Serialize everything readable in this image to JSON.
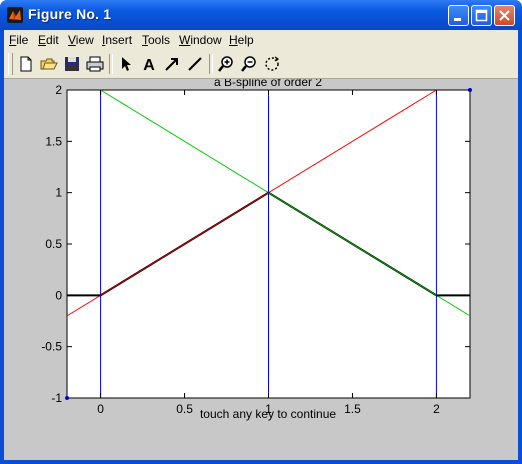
{
  "window": {
    "title": "Figure No. 1"
  },
  "menu": [
    {
      "label": "File",
      "key": "F",
      "rest": "ile"
    },
    {
      "label": "Edit",
      "key": "E",
      "rest": "dit"
    },
    {
      "label": "View",
      "key": "V",
      "rest": "iew"
    },
    {
      "label": "Insert",
      "key": "I",
      "rest": "nsert"
    },
    {
      "label": "Tools",
      "key": "T",
      "rest": "ools"
    },
    {
      "label": "Window",
      "key": "W",
      "rest": "indow"
    },
    {
      "label": "Help",
      "key": "H",
      "rest": "elp"
    }
  ],
  "toolbar": [
    {
      "icon": "new-file-icon"
    },
    {
      "icon": "open-folder-icon"
    },
    {
      "icon": "save-icon"
    },
    {
      "icon": "print-icon"
    },
    {
      "icon": "pointer-arrow-icon"
    },
    {
      "icon": "insert-text-icon"
    },
    {
      "icon": "insert-arrow-icon"
    },
    {
      "icon": "insert-line-icon"
    },
    {
      "icon": "zoom-in-icon"
    },
    {
      "icon": "zoom-out-icon"
    },
    {
      "icon": "rotate-icon"
    }
  ],
  "chart_data": {
    "type": "line",
    "title": "a B-spline of order 2",
    "xlabel": "touch any key to continue",
    "ylabel": "",
    "xlim": [
      -0.2,
      2.2
    ],
    "ylim": [
      -1,
      2
    ],
    "xticks": [
      0,
      0.5,
      1,
      1.5,
      2
    ],
    "xtick_labels": [
      "0",
      "0.5",
      "1",
      "1.5",
      "2"
    ],
    "yticks": [
      -1,
      -0.5,
      0,
      0.5,
      1,
      1.5,
      2
    ],
    "ytick_labels": [
      "-1",
      "-0.5",
      "0",
      "0.5",
      "1",
      "1.5",
      "2"
    ],
    "grid": false,
    "series": [
      {
        "color": "#0000ff",
        "style": "line",
        "x": [
          0,
          0
        ],
        "y": [
          -1,
          2
        ]
      },
      {
        "color": "#0000ff",
        "style": "line",
        "x": [
          1,
          1
        ],
        "y": [
          -1,
          2
        ]
      },
      {
        "color": "#0000ff",
        "style": "line",
        "x": [
          2,
          2
        ],
        "y": [
          -1,
          2
        ]
      },
      {
        "color": "#ff0000",
        "style": "line",
        "x": [
          -0.2,
          2
        ],
        "y": [
          -0.2,
          2
        ]
      },
      {
        "color": "#00cc00",
        "style": "line",
        "x": [
          0,
          2.2
        ],
        "y": [
          2,
          -0.2
        ]
      },
      {
        "color": "#000000",
        "style": "thick",
        "x": [
          -0.2,
          0,
          1,
          2,
          2.2
        ],
        "y": [
          0,
          0,
          1,
          0,
          0
        ]
      },
      {
        "color": "#cc0000",
        "style": "line",
        "x": [
          0,
          1
        ],
        "y": [
          0,
          1
        ]
      },
      {
        "color": "#00aa00",
        "style": "line",
        "x": [
          1,
          2
        ],
        "y": [
          1,
          0
        ]
      },
      {
        "color": "#0000ff",
        "style": "points",
        "x": [
          -0.2,
          2.2
        ],
        "y": [
          -1,
          2
        ]
      }
    ]
  }
}
